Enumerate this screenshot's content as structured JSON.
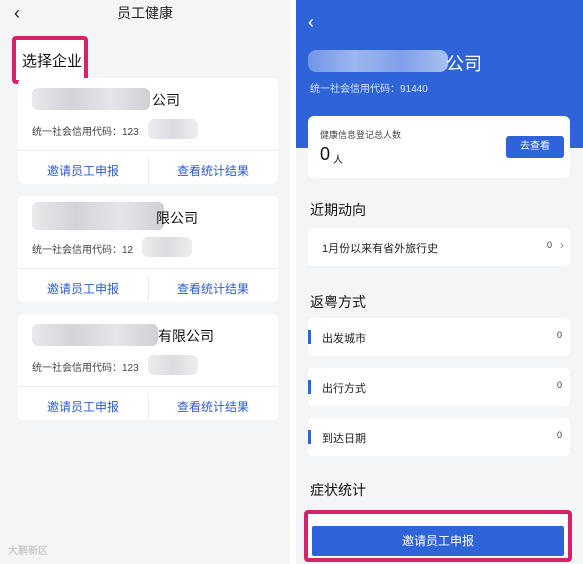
{
  "left": {
    "back_icon": "chevron-left-icon",
    "title": "员工健康",
    "select_label": "选择企业",
    "cards": [
      {
        "name_suffix": "公司",
        "credit_label": "统一社会信用代码：123",
        "invite": "邀请员工申报",
        "stats": "查看统计结果"
      },
      {
        "name_suffix": "限公司",
        "credit_label": "统一社会信用代码：12",
        "invite": "邀请员工申报",
        "stats": "查看统计结果"
      },
      {
        "name_suffix": "有限公司",
        "credit_label": "统一社会信用代码：123",
        "invite": "邀请员工申报",
        "stats": "查看统计结果"
      }
    ]
  },
  "right": {
    "back_icon": "chevron-left-icon",
    "company_suffix": "公司",
    "credit_label": "统一社会信用代码：91440",
    "summary": {
      "label": "健康信息登记总人数",
      "count": "0",
      "unit": "人",
      "check_button": "去查看"
    },
    "recent": {
      "title": "近期动向",
      "item_label": "1月份以来有省外旅行史",
      "item_value": "0"
    },
    "return": {
      "title": "返粤方式",
      "items": [
        {
          "label": "出发城市",
          "value": "0"
        },
        {
          "label": "出行方式",
          "value": "0"
        },
        {
          "label": "到达日期",
          "value": "0"
        }
      ]
    },
    "symptom_title": "症状统计",
    "invite_button": "邀请员工申报"
  },
  "watermark": "大鹏新区",
  "colors": {
    "accent": "#2f63d8",
    "highlight": "#d6216b",
    "background": "#f4f5f7"
  }
}
